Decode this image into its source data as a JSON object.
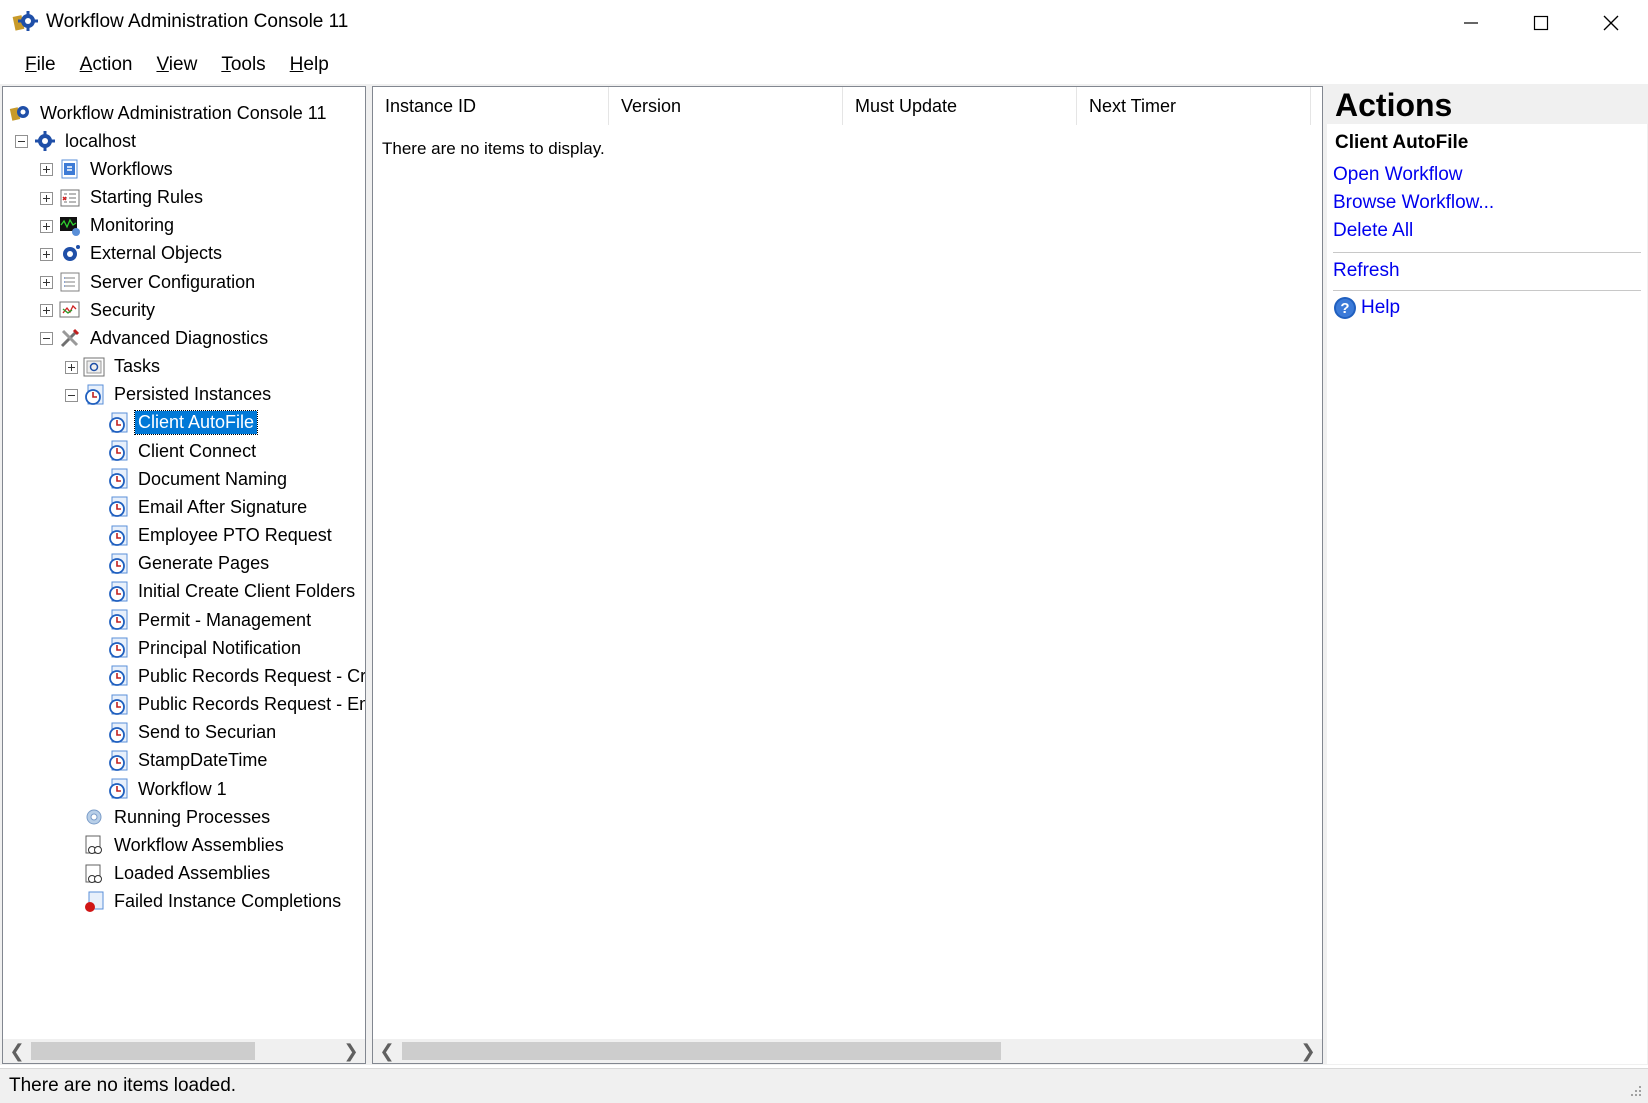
{
  "window": {
    "title": "Workflow Administration Console 11"
  },
  "menu": [
    {
      "pre": "",
      "u": "F",
      "post": "ile"
    },
    {
      "pre": "",
      "u": "A",
      "post": "ction"
    },
    {
      "pre": "",
      "u": "V",
      "post": "iew"
    },
    {
      "pre": "",
      "u": "T",
      "post": "ools"
    },
    {
      "pre": "",
      "u": "H",
      "post": "elp"
    }
  ],
  "tree": [
    {
      "label": "Workflow Administration Console 11",
      "level": 0,
      "expander": "none",
      "icon": "console-gear-icon"
    },
    {
      "label": "localhost",
      "level": 1,
      "expander": "minus",
      "icon": "server-gear-icon"
    },
    {
      "label": "Workflows",
      "level": 2,
      "expander": "plus",
      "icon": "workflows-icon"
    },
    {
      "label": "Starting Rules",
      "level": 2,
      "expander": "plus",
      "icon": "starting-rules-icon"
    },
    {
      "label": "Monitoring",
      "level": 2,
      "expander": "plus",
      "icon": "monitoring-icon"
    },
    {
      "label": "External Objects",
      "level": 2,
      "expander": "plus",
      "icon": "external-objects-icon"
    },
    {
      "label": "Server Configuration",
      "level": 2,
      "expander": "plus",
      "icon": "server-configuration-icon"
    },
    {
      "label": "Security",
      "level": 2,
      "expander": "plus",
      "icon": "security-icon"
    },
    {
      "label": "Advanced Diagnostics",
      "level": 2,
      "expander": "minus",
      "icon": "tools-icon"
    },
    {
      "label": "Tasks",
      "level": 3,
      "expander": "plus",
      "icon": "tasks-icon"
    },
    {
      "label": "Persisted Instances",
      "level": 3,
      "expander": "minus",
      "icon": "clock-doc-icon"
    },
    {
      "label": "Client AutoFile",
      "level": 4,
      "expander": "none",
      "icon": "clock-doc-icon",
      "selected": true
    },
    {
      "label": "Client Connect",
      "level": 4,
      "expander": "none",
      "icon": "clock-doc-icon"
    },
    {
      "label": "Document Naming",
      "level": 4,
      "expander": "none",
      "icon": "clock-doc-icon"
    },
    {
      "label": "Email After Signature",
      "level": 4,
      "expander": "none",
      "icon": "clock-doc-icon"
    },
    {
      "label": "Employee PTO Request",
      "level": 4,
      "expander": "none",
      "icon": "clock-doc-icon"
    },
    {
      "label": "Generate Pages",
      "level": 4,
      "expander": "none",
      "icon": "clock-doc-icon"
    },
    {
      "label": "Initial Create Client Folders",
      "level": 4,
      "expander": "none",
      "icon": "clock-doc-icon"
    },
    {
      "label": "Permit - Management",
      "level": 4,
      "expander": "none",
      "icon": "clock-doc-icon"
    },
    {
      "label": "Principal Notification",
      "level": 4,
      "expander": "none",
      "icon": "clock-doc-icon"
    },
    {
      "label": "Public Records Request - Crea",
      "level": 4,
      "expander": "none",
      "icon": "clock-doc-icon"
    },
    {
      "label": "Public Records Request - Ema",
      "level": 4,
      "expander": "none",
      "icon": "clock-doc-icon"
    },
    {
      "label": "Send to Securian",
      "level": 4,
      "expander": "none",
      "icon": "clock-doc-icon"
    },
    {
      "label": "StampDateTime",
      "level": 4,
      "expander": "none",
      "icon": "clock-doc-icon"
    },
    {
      "label": "Workflow 1",
      "level": 4,
      "expander": "none",
      "icon": "clock-doc-icon"
    },
    {
      "label": "Running Processes",
      "level": 3,
      "expander": "none",
      "icon": "gear-icon"
    },
    {
      "label": "Workflow Assemblies",
      "level": 3,
      "expander": "none",
      "icon": "assembly-icon"
    },
    {
      "label": "Loaded Assemblies",
      "level": 3,
      "expander": "none",
      "icon": "assembly-icon"
    },
    {
      "label": "Failed Instance Completions",
      "level": 3,
      "expander": "none",
      "icon": "failed-icon"
    }
  ],
  "list": {
    "columns": [
      "Instance ID",
      "Version",
      "Must Update",
      "Next Timer"
    ],
    "empty_message": "There are no items to display."
  },
  "actions": {
    "title": "Actions",
    "section": "Client AutoFile",
    "links": [
      "Open Workflow",
      "Browse Workflow...",
      "Delete All"
    ],
    "refresh": "Refresh",
    "help": "Help",
    "link_color": "#0000ee"
  },
  "status": {
    "text": "There are no items loaded."
  },
  "colors": {
    "selection": "#0078d7",
    "accent_blue": "#1f5fbf"
  }
}
